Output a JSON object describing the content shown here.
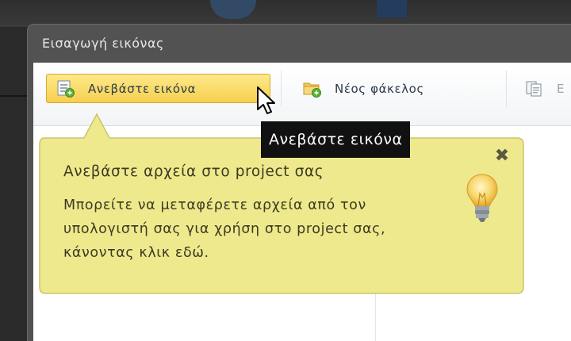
{
  "dialog": {
    "title": "Εισαγωγή εικόνας"
  },
  "toolbar": {
    "upload_label": "Ανεβάστε εικόνα",
    "new_folder_label": "Νέος φάκελος",
    "copy_label": "Ε",
    "upload_icon": "upload-image-icon",
    "new_folder_icon": "new-folder-icon",
    "copy_icon": "copy-icon"
  },
  "tooltip": {
    "text": "Ανεβάστε εικόνα"
  },
  "hint": {
    "title": "Ανεβάστε αρχεία στο project σας",
    "body": "Μπορείτε να μεταφέρετε αρχεία από τον υπολογιστή σας για χρήση στο project σας, κάνοντας κλικ εδώ.",
    "close_symbol": "✖",
    "icon": "lightbulb-icon"
  },
  "colors": {
    "button_active": "#f7cf4f",
    "hint_background": "#f0ea8e",
    "hint_border": "#c9c068",
    "tooltip_background": "#111111"
  }
}
